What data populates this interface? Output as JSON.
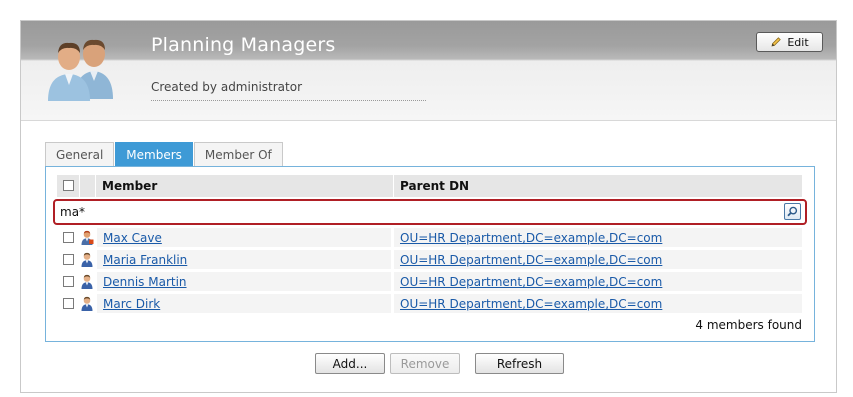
{
  "header": {
    "title": "Planning Managers",
    "subtitle": "Created by administrator",
    "edit_label": "Edit",
    "avatar_icon": "group-users-icon",
    "edit_icon": "pencil-icon"
  },
  "tabs": [
    {
      "label": "General",
      "active": false
    },
    {
      "label": "Members",
      "active": true
    },
    {
      "label": "Member Of",
      "active": false
    }
  ],
  "table": {
    "columns": [
      "Member",
      "Parent DN"
    ],
    "filter_value": "ma*",
    "search_icon": "magnifier-icon",
    "rows": [
      {
        "member": "Max Cave",
        "parent_dn": "OU=HR Department,DC=example,DC=com",
        "icon": "user-admin-icon"
      },
      {
        "member": "Maria Franklin",
        "parent_dn": "OU=HR Department,DC=example,DC=com",
        "icon": "user-icon"
      },
      {
        "member": "Dennis Martin",
        "parent_dn": "OU=HR Department,DC=example,DC=com",
        "icon": "user-icon"
      },
      {
        "member": "Marc Dirk",
        "parent_dn": "OU=HR Department,DC=example,DC=com",
        "icon": "user-icon"
      }
    ],
    "found_text": "4 members found"
  },
  "actions": {
    "add_label": "Add...",
    "remove_label": "Remove",
    "refresh_label": "Refresh"
  },
  "colors": {
    "tab_active": "#3e9ad6",
    "link": "#1a5aa8",
    "filter_border": "#b01f25",
    "box_border": "#76b3dc"
  }
}
